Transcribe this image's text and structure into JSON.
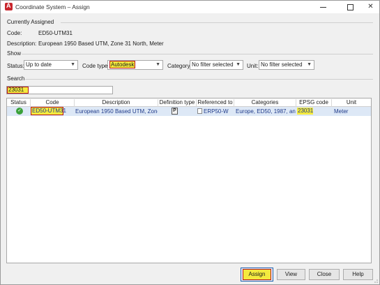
{
  "window": {
    "title": "Coordinate System – Assign",
    "controls": {
      "minimize": "",
      "maximize": "",
      "close": "✕"
    }
  },
  "currently_assigned": {
    "heading": "Currently Assigned",
    "code_label": "Code:",
    "code_value": "ED50-UTM31",
    "description_label": "Description:",
    "description_value": "European 1950 Based UTM, Zone 31 North, Meter"
  },
  "show": {
    "heading": "Show",
    "status_label": "Status:",
    "status_value": "Up to date",
    "code_type_label": "Code type:",
    "code_type_value": "Autodesk",
    "category_label": "Category:",
    "category_value": "No filter selected",
    "unit_label": "Unit:",
    "unit_value": "No filter selected"
  },
  "search": {
    "heading": "Search",
    "value": "23031"
  },
  "table": {
    "columns": [
      "Status",
      "Code",
      "Description",
      "Definition type",
      "Referenced to",
      "Categories",
      "EPSG code",
      "Unit"
    ],
    "rows": [
      {
        "status": "ok",
        "code": "ED50-UTM31",
        "description": "European 1950 Based UTM, Zone...",
        "definition_type": "P",
        "referenced_to": "ERP50-W",
        "categories": "Europe, ED50, 1987, and...",
        "epsg_code": "23031",
        "unit": "Meter"
      }
    ]
  },
  "buttons": {
    "assign": "Assign",
    "view": "View",
    "close": "Close",
    "help": "Help"
  },
  "colors": {
    "highlight": "#f4ea3e",
    "highlight_border": "#b5121b",
    "selected_row": "#dde8f6",
    "status_ok": "#3aa13a"
  }
}
